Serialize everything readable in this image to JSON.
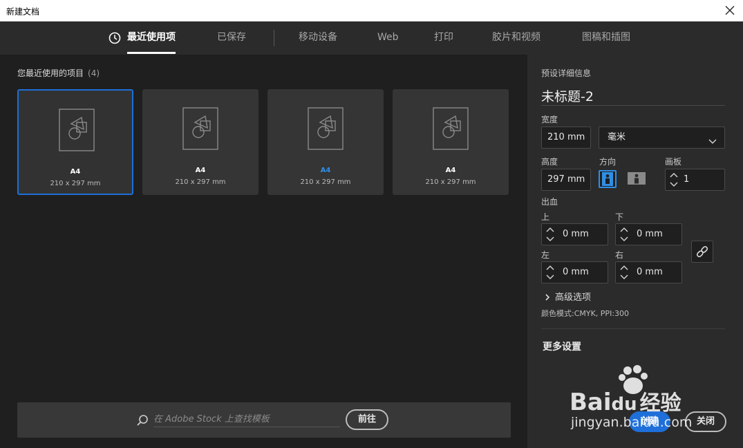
{
  "window": {
    "title": "新建文档"
  },
  "tabs": [
    {
      "label": "最近使用项",
      "active": true
    },
    {
      "label": "已保存"
    },
    {
      "label": "移动设备"
    },
    {
      "label": "Web"
    },
    {
      "label": "打印"
    },
    {
      "label": "胶片和视频"
    },
    {
      "label": "图稿和插图"
    }
  ],
  "recent": {
    "heading": "您最近使用的项目",
    "count": "(4)",
    "items": [
      {
        "name": "A4",
        "size": "210 x 297 mm"
      },
      {
        "name": "A4",
        "size": "210 x 297 mm"
      },
      {
        "name": "A4",
        "size": "210 x 297 mm"
      },
      {
        "name": "A4",
        "size": "210 x 297 mm"
      }
    ]
  },
  "search": {
    "placeholder": "在 Adobe Stock 上查找模板",
    "button": "前往"
  },
  "details": {
    "heading": "预设详细信息",
    "title": "未标题-2",
    "width_label": "宽度",
    "width_value": "210 mm",
    "unit": "毫米",
    "height_label": "高度",
    "height_value": "297 mm",
    "orientation_label": "方向",
    "artboard_label": "画板",
    "artboard_value": "1",
    "bleed_label": "出血",
    "bleed_top_label": "上",
    "bleed_top": "0 mm",
    "bleed_bottom_label": "下",
    "bleed_bottom": "0 mm",
    "bleed_left_label": "左",
    "bleed_left": "0 mm",
    "bleed_right_label": "右",
    "bleed_right": "0 mm",
    "advanced": "高级选项",
    "color_mode": "颜色模式:CMYK, PPI:300",
    "more_settings": "更多设置",
    "create_button": "创建",
    "close_button": "关闭"
  },
  "watermark": {
    "brand": "Bai",
    "brand2": "du",
    "cn": "经验",
    "url": "jingyan.baidu.com"
  },
  "colors": {
    "accent": "#1e6fd9",
    "panel": "#2b2b2b",
    "background": "#1f1f1f"
  }
}
